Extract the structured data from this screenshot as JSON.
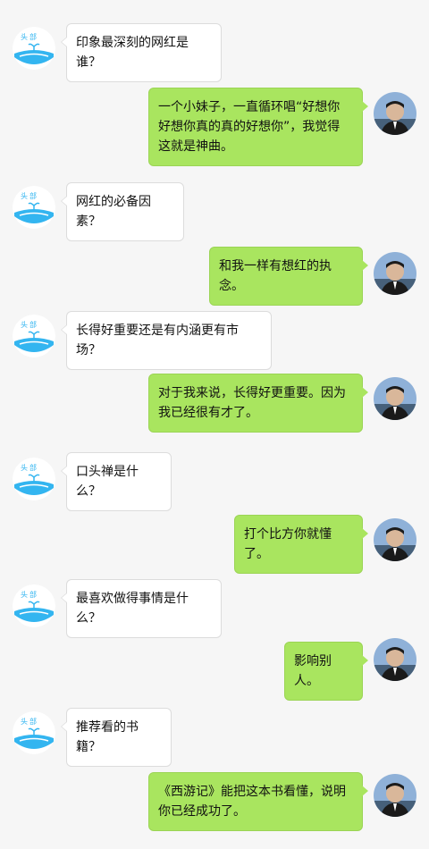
{
  "colors": {
    "background": "#f6f6f6",
    "incoming_bubble": "#ffffff",
    "outgoing_bubble": "#a9e55f",
    "brand_blue": "#33b5f0"
  },
  "icons": {
    "incoming_avatar": "whale-logo-icon",
    "outgoing_avatar": "user-photo-avatar"
  },
  "conversation": [
    {
      "from": "interviewer",
      "text": "印象最深刻的网红是谁？"
    },
    {
      "from": "me",
      "text": "一个小妹子，一直循环唱“好想你\n好想你真的真的好想你”，我觉得\n这就是神曲。"
    },
    {
      "from": "interviewer",
      "text": "网红的必备因素？"
    },
    {
      "from": "me",
      "text": "和我一样有想红的执念。"
    },
    {
      "from": "interviewer",
      "text": "长得好重要还是有内涵更有市场？"
    },
    {
      "from": "me",
      "text": "对于我来说，长得好更重要。因为\n我已经很有才了。"
    },
    {
      "from": "interviewer",
      "text": "口头禅是什么？"
    },
    {
      "from": "me",
      "text": "打个比方你就懂了。"
    },
    {
      "from": "interviewer",
      "text": "最喜欢做得事情是什么？"
    },
    {
      "from": "me",
      "text": "影响别人。"
    },
    {
      "from": "interviewer",
      "text": "推荐看的书籍？"
    },
    {
      "from": "me",
      "text": "《西游记》能把这本书看懂，说明\n你已经成功了。"
    }
  ]
}
